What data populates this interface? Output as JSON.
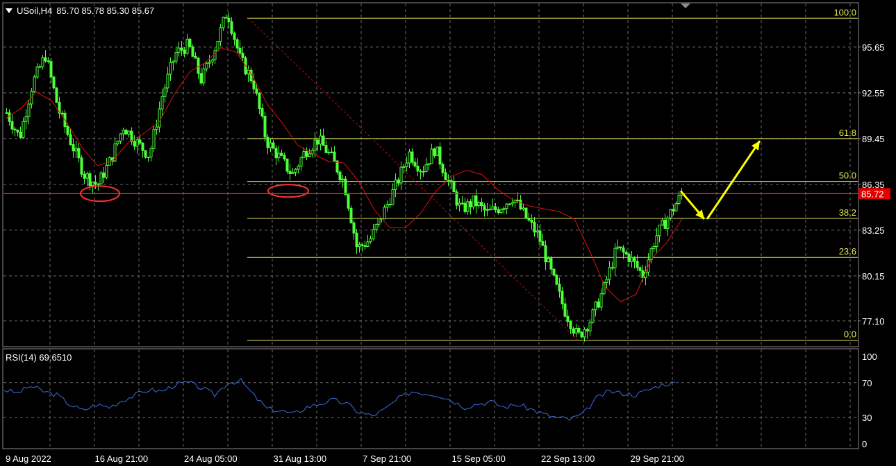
{
  "header": {
    "symbol": "USoil,H4",
    "ohlc": "85.70 85.78 85.30 85.67"
  },
  "rsi_header": "RSI(14) 69.6510",
  "current_price": "85.72",
  "colors": {
    "background": "#000000",
    "grid": "#6b6b6b",
    "candles": "#4cff3a",
    "moving_average": "#e01010",
    "fibonacci": "#e8e85a",
    "support_line": "#ff2020",
    "rsi_line": "#3a6fe0",
    "arrows": "#ffff00",
    "circles": "#ff3030"
  },
  "chart_data": [
    {
      "type": "line",
      "title": "USoil,H4",
      "ylim": [
        75.4,
        98.6
      ],
      "y_ticks": [
        "95.65",
        "92.55",
        "89.45",
        "86.35",
        "83.25",
        "80.15",
        "77.10"
      ],
      "x_ticks": [
        "9 Aug 2022",
        "16 Aug 21:00",
        "24 Aug 05:00",
        "31 Aug 13:00",
        "7 Sep 21:00",
        "15 Sep 05:00",
        "22 Sep 13:00",
        "29 Sep 21:00"
      ],
      "series": [
        {
          "values": [
            91.2,
            89.5,
            93.2,
            95.1,
            91.4,
            89.1,
            87.0,
            86.3,
            88.0,
            90.3,
            89.2,
            88.3,
            92.4,
            95.2,
            95.8,
            93.4,
            95.5,
            98.1,
            94.8,
            93.3,
            89.3,
            88.2,
            87.0,
            88.6,
            89.4,
            88.2,
            86.5,
            82.0,
            82.6,
            84.4,
            86.3,
            88.5,
            87.3,
            88.8,
            86.6,
            84.6,
            85.2,
            84.4,
            84.8,
            85.5,
            84.1,
            82.8,
            80.2,
            77.8,
            76.0,
            77.2,
            79.3,
            82.0,
            81.4,
            80.2,
            82.8,
            84.2,
            85.7
          ]
        },
        {
          "values": [
            90.8,
            91.5,
            92.6,
            92.0,
            90.5,
            88.8,
            87.6,
            88.0,
            89.2,
            89.8,
            90.6,
            92.5,
            94.0,
            94.6,
            95.6,
            95.3,
            93.8,
            91.8,
            90.5,
            89.0,
            88.4,
            87.9,
            87.8,
            86.5,
            84.6,
            83.4,
            83.4,
            84.4,
            85.9,
            86.9,
            87.3,
            87.0,
            86.0,
            85.3,
            84.9,
            84.7,
            84.5,
            84.0,
            81.8,
            79.4,
            78.4,
            78.9,
            81.3,
            82.4,
            84.0
          ]
        }
      ],
      "fibonacci": [
        {
          "label": "100.0",
          "value": 97.6
        },
        {
          "label": "61.8",
          "value": 89.45
        },
        {
          "label": "50.0",
          "value": 86.55
        },
        {
          "label": "38.2",
          "value": 84.05
        },
        {
          "label": "23.6",
          "value": 81.4
        },
        {
          "label": "0.0",
          "value": 75.8
        }
      ],
      "support_level": 85.72,
      "projection_arrows": [
        [
          85.9,
          84.0
        ],
        [
          84.0,
          89.3
        ]
      ]
    },
    {
      "type": "line",
      "title": "RSI(14) 69.6510",
      "ylim": [
        0,
        100
      ],
      "y_ticks": [
        "100",
        "70",
        "30",
        "0"
      ],
      "series": [
        {
          "values": [
            62,
            58,
            66,
            60,
            56,
            45,
            38,
            45,
            42,
            50,
            56,
            62,
            60,
            68,
            70,
            64,
            56,
            70,
            72,
            55,
            40,
            38,
            34,
            42,
            46,
            50,
            46,
            36,
            32,
            40,
            52,
            60,
            58,
            56,
            50,
            42,
            46,
            48,
            42,
            45,
            40,
            34,
            30,
            28,
            34,
            52,
            60,
            58,
            56,
            62,
            68,
            70
          ]
        }
      ]
    }
  ]
}
